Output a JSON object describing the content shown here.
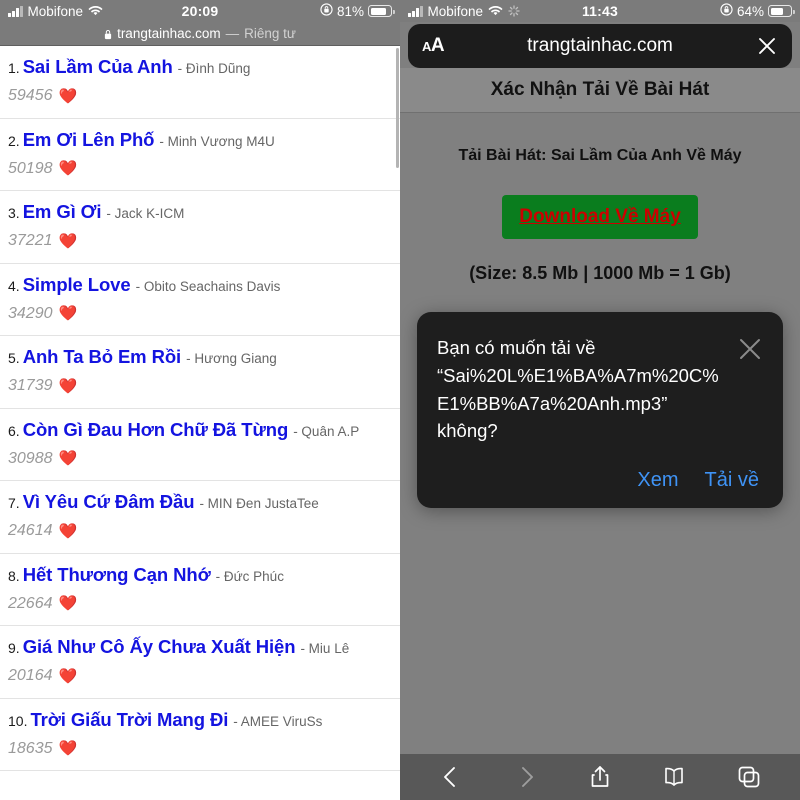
{
  "left": {
    "status_bar": {
      "carrier": "Mobifone",
      "wifi_icon": "wifi-icon",
      "time": "20:09",
      "rotation_lock_icon": "rotation-lock-icon",
      "battery_percent": "81%",
      "battery_icon": "battery-icon"
    },
    "url_bar": {
      "lock_icon": "lock-icon",
      "host": "trangtainhac.com",
      "separator": "—",
      "private_label": "Riêng tư"
    },
    "songs": [
      {
        "rank": "1.",
        "title": "Sai Lầm Của Anh",
        "artist": "- Đình Dũng",
        "views": "59456",
        "heart": "❤️"
      },
      {
        "rank": "2.",
        "title": "Em Ơi Lên Phố",
        "artist": "- Minh Vương M4U",
        "views": "50198",
        "heart": "❤️"
      },
      {
        "rank": "3.",
        "title": "Em Gì Ơi",
        "artist": "- Jack K-ICM",
        "views": "37221",
        "heart": "❤️"
      },
      {
        "rank": "4.",
        "title": "Simple Love",
        "artist": "- Obito Seachains Davis",
        "views": "34290",
        "heart": "❤️"
      },
      {
        "rank": "5.",
        "title": "Anh Ta Bỏ Em Rồi",
        "artist": "- Hương Giang",
        "views": "31739",
        "heart": "❤️"
      },
      {
        "rank": "6.",
        "title": "Còn Gì Đau Hơn Chữ Đã Từng",
        "artist": "- Quân A.P",
        "views": "30988",
        "heart": "❤️"
      },
      {
        "rank": "7.",
        "title": "Vì Yêu Cứ Đâm Đầu",
        "artist": "- MIN Đen JustaTee",
        "views": "24614",
        "heart": "❤️"
      },
      {
        "rank": "8.",
        "title": "Hết Thương Cạn Nhớ",
        "artist": "- Đức Phúc",
        "views": "22664",
        "heart": "❤️"
      },
      {
        "rank": "9.",
        "title": "Giá Như Cô Ấy Chưa Xuất Hiện",
        "artist": "- Miu Lê",
        "views": "20164",
        "heart": "❤️"
      },
      {
        "rank": "10.",
        "title": "Trời Giấu Trời Mang Đi",
        "artist": "- AMEE ViruSs",
        "views": "18635",
        "heart": "❤️"
      }
    ]
  },
  "right": {
    "status_bar": {
      "carrier": "Mobifone",
      "wifi_icon": "wifi-icon",
      "activity_icon": "activity-spinner-icon",
      "time": "11:43",
      "rotation_lock_icon": "rotation-lock-icon",
      "battery_percent": "64%",
      "battery_icon": "battery-icon"
    },
    "safari_url_bar": {
      "text_size_label_small": "A",
      "text_size_label_large": "A",
      "host": "trangtainhac.com",
      "close_icon": "close-icon"
    },
    "page": {
      "header_title": "Xác Nhận Tải Về Bài Hát",
      "subtitle": "Tải Bài Hát: Sai Lầm Của Anh Về Máy",
      "download_button": "Download Về Máy",
      "size_note": "(Size: 8.5 Mb | 1000 Mb = 1 Gb)"
    },
    "dialog": {
      "message": "Bạn có muốn tải về\n“Sai%20L%E1%BA%A7m%20C%\nE1%BB%A7a%20Anh.mp3”\nkhông?",
      "close_icon": "close-icon",
      "view_button": "Xem",
      "download_button": "Tải về"
    },
    "toolbar": {
      "back_icon": "chevron-left-icon",
      "forward_icon": "chevron-right-icon",
      "share_icon": "share-icon",
      "bookmarks_icon": "book-icon",
      "tabs_icon": "tabs-icon"
    }
  },
  "colors": {
    "title_link": "#1414e0",
    "download_green": "#0a7d1e",
    "download_red": "#cc0000",
    "dialog_action_blue": "#3f93f5"
  }
}
